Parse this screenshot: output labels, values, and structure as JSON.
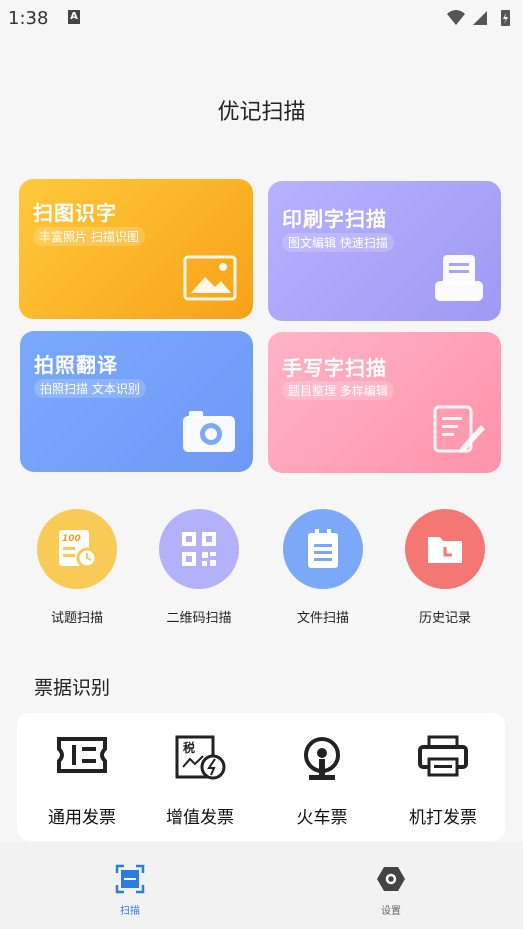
{
  "status": {
    "time": "1:38"
  },
  "app": {
    "title": "优记扫描"
  },
  "cards": [
    {
      "title": "扫图识字",
      "subtitle": "丰富照片 扫描识图",
      "icon": "image-icon"
    },
    {
      "title": "印刷字扫描",
      "subtitle": "图文编辑 快速扫描",
      "icon": "printer-doc-icon"
    },
    {
      "title": "拍照翻译",
      "subtitle": "拍照扫描 文本识别",
      "icon": "camera-icon"
    },
    {
      "title": "手写字扫描",
      "subtitle": "题目整理 多样编辑",
      "icon": "handwriting-icon"
    }
  ],
  "quick_actions": [
    {
      "label": "试题扫描",
      "icon": "exam-icon",
      "color": "#f8ca56"
    },
    {
      "label": "二维码扫描",
      "icon": "qr-code-icon",
      "color": "#b3b1fb"
    },
    {
      "label": "文件扫描",
      "icon": "clipboard-icon",
      "color": "#7ba9f7"
    },
    {
      "label": "历史记录",
      "icon": "history-folder-icon",
      "color": "#f47773"
    }
  ],
  "invoice_section": {
    "title": "票据识别",
    "items": [
      {
        "label": "通用发票",
        "icon": "ticket-icon"
      },
      {
        "label": "增值发票",
        "icon": "tax-invoice-icon"
      },
      {
        "label": "火车票",
        "icon": "train-icon"
      },
      {
        "label": "机打发票",
        "icon": "printer-icon"
      }
    ]
  },
  "tabbar": {
    "items": [
      {
        "label": "扫描",
        "active": true
      },
      {
        "label": "设置",
        "active": false
      }
    ],
    "active_color": "#2a7de1"
  }
}
